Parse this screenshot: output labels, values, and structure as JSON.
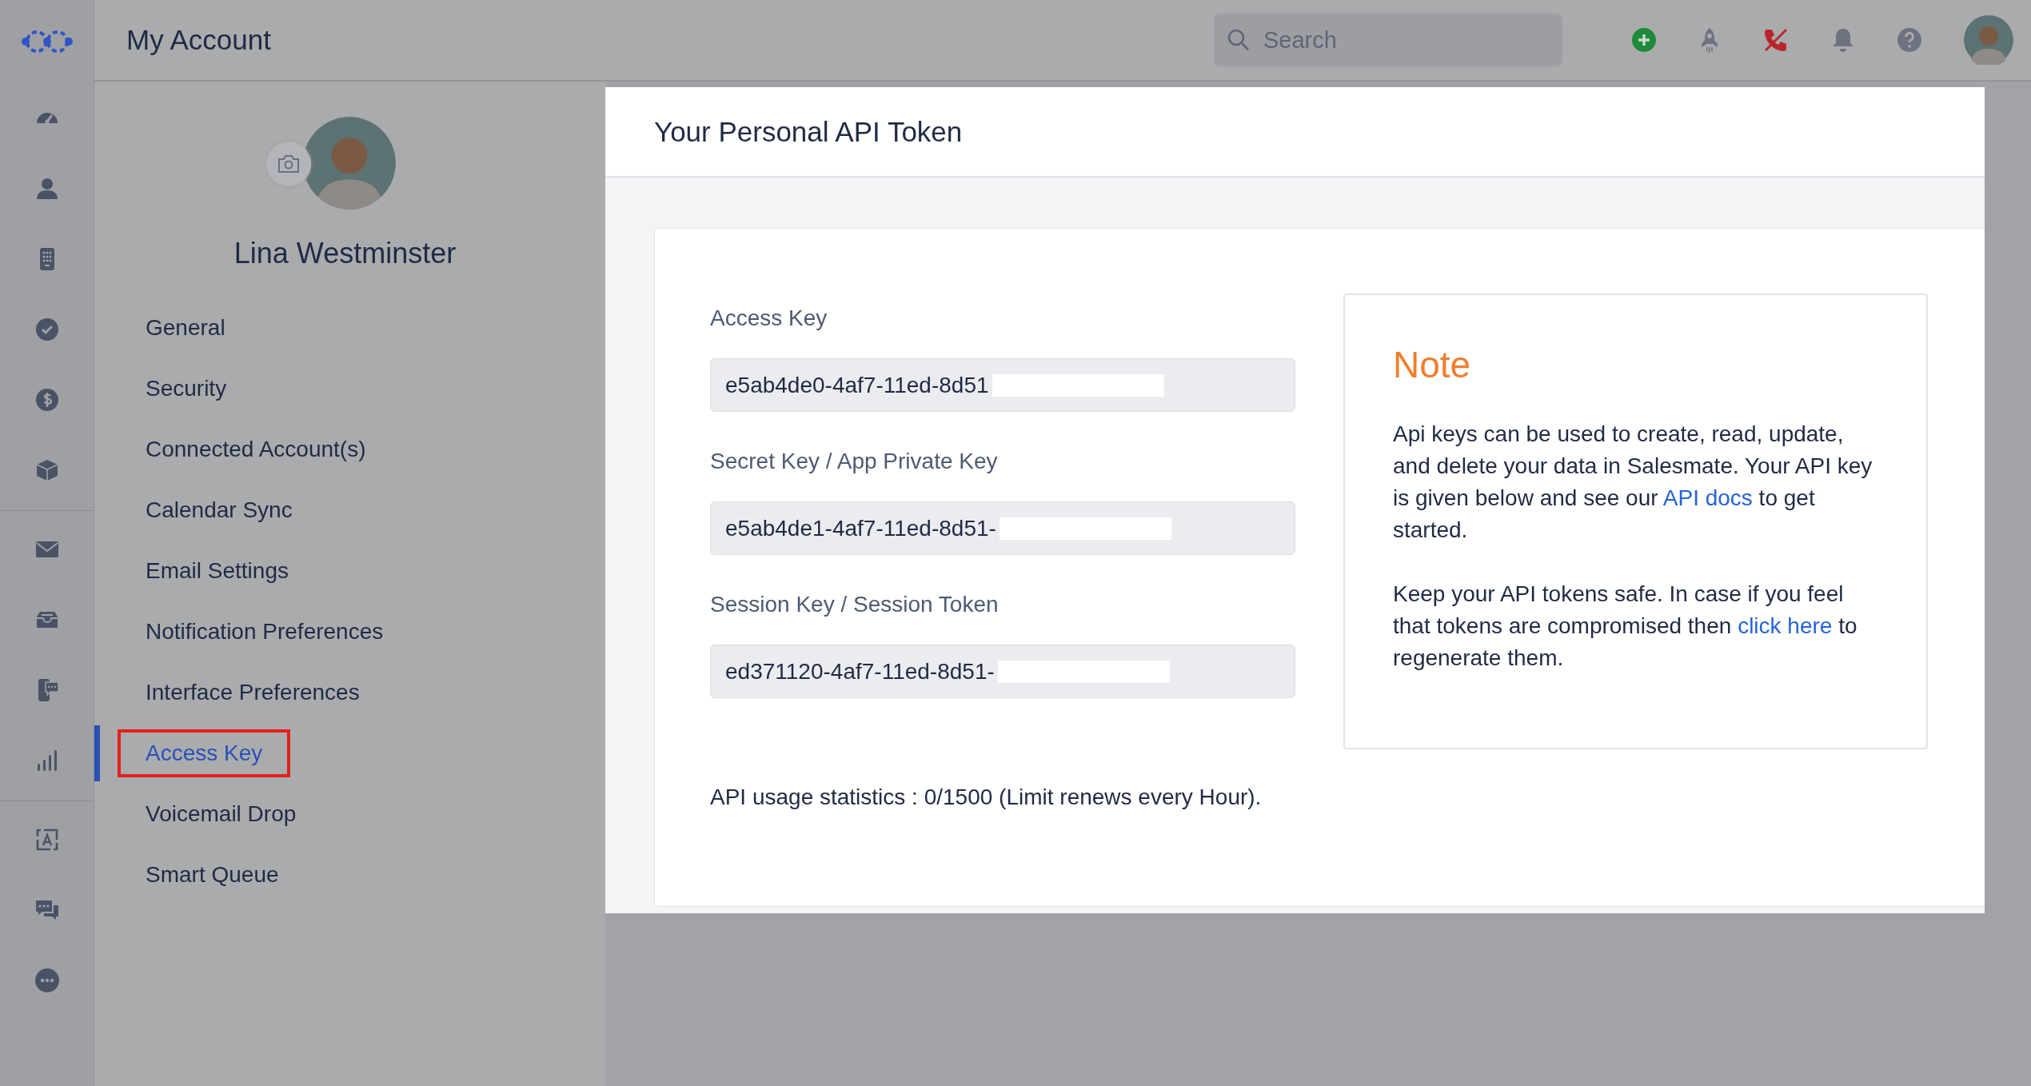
{
  "topbar": {
    "title": "My Account",
    "search": {
      "placeholder": "Search"
    }
  },
  "profile": {
    "name": "Lina Westminster"
  },
  "menu": [
    {
      "label": "General",
      "selected": false,
      "outlined": false
    },
    {
      "label": "Security",
      "selected": false,
      "outlined": false
    },
    {
      "label": "Connected Account(s)",
      "selected": false,
      "outlined": false
    },
    {
      "label": "Calendar Sync",
      "selected": false,
      "outlined": false
    },
    {
      "label": "Email Settings",
      "selected": false,
      "outlined": false
    },
    {
      "label": "Notification Preferences",
      "selected": false,
      "outlined": false
    },
    {
      "label": "Interface Preferences",
      "selected": false,
      "outlined": false
    },
    {
      "label": "Access Key",
      "selected": true,
      "outlined": true
    },
    {
      "label": "Voicemail Drop",
      "selected": false,
      "outlined": false
    },
    {
      "label": "Smart Queue",
      "selected": false,
      "outlined": false
    }
  ],
  "modal": {
    "title": "Your Personal API Token",
    "fields": [
      {
        "label": "Access Key",
        "value": "e5ab4de0-4af7-11ed-8d51",
        "redacted": true
      },
      {
        "label": "Secret Key / App Private Key",
        "value": "e5ab4de1-4af7-11ed-8d51-",
        "redacted": true
      },
      {
        "label": "Session Key / Session Token",
        "value": "ed371120-4af7-11ed-8d51-",
        "redacted": true
      }
    ],
    "usage": "API usage statistics : 0/1500 (Limit renews every Hour).",
    "note": {
      "title": "Note",
      "paragraphs": [
        [
          {
            "kind": "text",
            "text": "Api keys can be used to create, read, update, and delete your data in Salesmate. Your API key is given below and see our "
          },
          {
            "kind": "link",
            "text": "API docs"
          },
          {
            "kind": "text",
            "text": " to get started."
          }
        ],
        [
          {
            "kind": "text",
            "text": "Keep your API tokens safe. In case if you feel that tokens are compromised then "
          },
          {
            "kind": "link",
            "text": "click here"
          },
          {
            "kind": "text",
            "text": " to regenerate them."
          }
        ]
      ]
    }
  }
}
